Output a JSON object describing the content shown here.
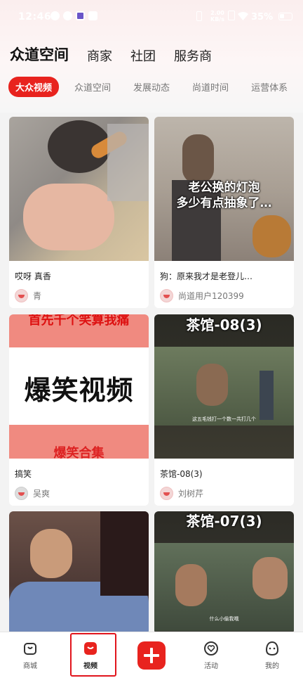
{
  "status_bar": {
    "time": "12:46",
    "network_line1": "2.00",
    "network_line2": "KB/s",
    "battery": "35%"
  },
  "main_tabs": [
    {
      "label": "众道空间",
      "active": true
    },
    {
      "label": "商家",
      "active": false
    },
    {
      "label": "社团",
      "active": false
    },
    {
      "label": "服务商",
      "active": false
    }
  ],
  "sub_tabs": [
    {
      "label": "大众视频",
      "active": true
    },
    {
      "label": "众道空间",
      "active": false
    },
    {
      "label": "发展动态",
      "active": false
    },
    {
      "label": "尚道时间",
      "active": false
    },
    {
      "label": "运营体系",
      "active": false
    }
  ],
  "cards": [
    {
      "title": "哎呀 真香",
      "author": "青",
      "overlay": ""
    },
    {
      "title": "狗：原来我才是老登儿…",
      "author": "尚道用户120399",
      "overlay": "老公换的灯泡\n多少有点抽象了…"
    },
    {
      "title": "搞笑",
      "author": "吴爽",
      "overlay": "爆笑视频",
      "overlay_top": "首先千个笑算我痛",
      "overlay_bottom": "爆笑合集"
    },
    {
      "title": "茶馆-08(3)",
      "author": "刘树芹",
      "overlay": "茶馆-08(3)",
      "caption": "这五毛钱打一个数一共打几个"
    },
    {
      "title": "",
      "author": "",
      "overlay": ""
    },
    {
      "title": "",
      "author": "",
      "overlay": "茶馆-07(3)",
      "caption": "什么小偷我哦"
    }
  ],
  "bottom_nav": [
    {
      "label": "商城",
      "icon": "shop-icon"
    },
    {
      "label": "视频",
      "icon": "video-icon",
      "active": true
    },
    {
      "label": "",
      "icon": "plus-icon"
    },
    {
      "label": "活动",
      "icon": "heart-icon"
    },
    {
      "label": "我的",
      "icon": "profile-icon"
    }
  ],
  "colors": {
    "accent": "#e8231e",
    "highlight": "#e1141c"
  }
}
